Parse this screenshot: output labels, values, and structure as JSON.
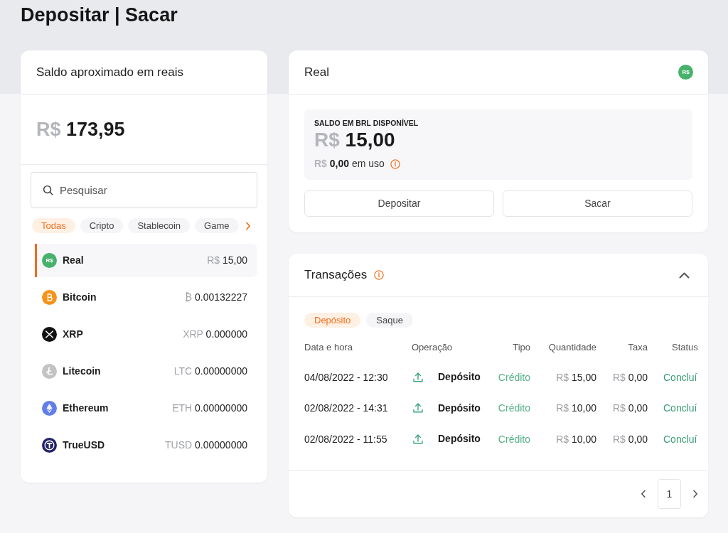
{
  "page": {
    "title": "Depositar | Sacar"
  },
  "balance_card": {
    "title": "Saldo aproximado em reais",
    "total": {
      "currency": "R$",
      "amount": "173,95"
    },
    "search": {
      "placeholder": "Pesquisar"
    },
    "filters": [
      {
        "label": "Todas",
        "selected": true
      },
      {
        "label": "Cripto",
        "selected": false
      },
      {
        "label": "Stablecoin",
        "selected": false
      },
      {
        "label": "Game",
        "selected": false
      }
    ],
    "assets": [
      {
        "kind": "real",
        "logo_text": "R$",
        "name": "Real",
        "symbol": "R$",
        "amount": "15,00",
        "selected": true
      },
      {
        "kind": "bitcoin",
        "name": "Bitcoin",
        "symbol": "₿",
        "amount": "0.00132227",
        "selected": false
      },
      {
        "kind": "xrp",
        "name": "XRP",
        "symbol": "XRP",
        "amount": "0.000000",
        "selected": false
      },
      {
        "kind": "litecoin",
        "name": "Litecoin",
        "symbol": "LTC",
        "amount": "0.00000000",
        "selected": false
      },
      {
        "kind": "ethereum",
        "name": "Ethereum",
        "symbol": "ETH",
        "amount": "0.00000000",
        "selected": false
      },
      {
        "kind": "trueusd",
        "name": "TrueUSD",
        "symbol": "TUSD",
        "amount": "0.00000000",
        "selected": false
      }
    ]
  },
  "currency_card": {
    "title": "Real",
    "logo_text": "R$",
    "available_label": "SALDO EM BRL DISPONÍVEL",
    "available": {
      "currency": "R$",
      "amount": "15,00"
    },
    "in_use": {
      "currency": "R$",
      "amount": "0,00",
      "suffix": "em uso"
    },
    "buttons": [
      "Depositar",
      "Sacar"
    ]
  },
  "transactions": {
    "title": "Transações",
    "expanded": true,
    "tabs": [
      {
        "label": "Depósito",
        "selected": true
      },
      {
        "label": "Saque",
        "selected": false
      }
    ],
    "columns": [
      "Data e hora",
      "Operação",
      "Tipo",
      "Quantidade",
      "Taxa",
      "Status"
    ],
    "rows": [
      {
        "date": "04/08/2022 - 12:30",
        "operation": "Depósito",
        "type": "Crédito",
        "quantity": {
          "currency": "R$",
          "amount": "15,00"
        },
        "fee": {
          "currency": "R$",
          "amount": "0,00"
        },
        "status": "Concluí"
      },
      {
        "date": "02/08/2022 - 14:31",
        "operation": "Depósito",
        "type": "Crédito",
        "quantity": {
          "currency": "R$",
          "amount": "10,00"
        },
        "fee": {
          "currency": "R$",
          "amount": "0,00"
        },
        "status": "Concluí"
      },
      {
        "date": "02/08/2022 - 11:55",
        "operation": "Depósito",
        "type": "Crédito",
        "quantity": {
          "currency": "R$",
          "amount": "10,00"
        },
        "fee": {
          "currency": "R$",
          "amount": "0,00"
        },
        "status": "Concluí"
      }
    ],
    "pages": [
      {
        "label": "1",
        "selected": true
      }
    ]
  }
}
